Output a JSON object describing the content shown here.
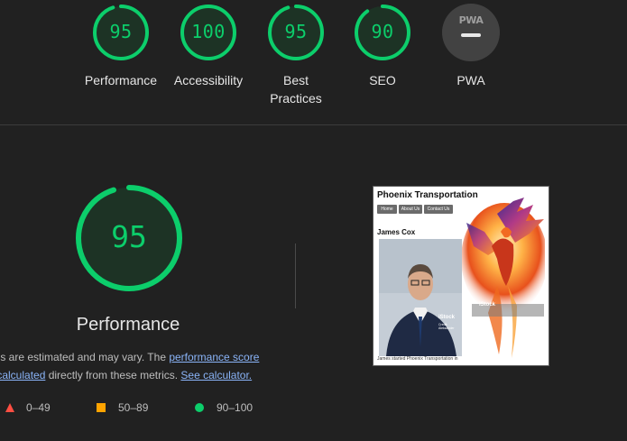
{
  "categories": [
    {
      "id": "performance",
      "score": "95",
      "label": "Performance",
      "value": 95
    },
    {
      "id": "accessibility",
      "score": "100",
      "label": "Accessibility",
      "value": 100
    },
    {
      "id": "best-practices",
      "score": "95",
      "label": "Best Practices",
      "value": 95
    },
    {
      "id": "seo",
      "score": "90",
      "label": "SEO",
      "value": 90
    },
    {
      "id": "pwa",
      "score": "",
      "label": "PWA",
      "badge_text": "PWA"
    }
  ],
  "detail": {
    "score": "95",
    "value": 95,
    "title": "Performance",
    "desc_prefix": "ues are estimated and may vary. The ",
    "desc_link1": "performance score",
    "desc_line2_link": "s calculated",
    "desc_mid": " directly from these metrics. ",
    "desc_link2": "See calculator."
  },
  "legend": [
    {
      "shape": "triangle",
      "range": "0–49",
      "color": "#ff4e42"
    },
    {
      "shape": "square",
      "range": "50–89",
      "color": "#ffa400"
    },
    {
      "shape": "circle",
      "range": "90–100",
      "color": "#0cce6b"
    }
  ],
  "screenshot": {
    "site_title": "Phoenix Transportation",
    "nav": [
      "Home",
      "About Us",
      "Contact Us"
    ],
    "person_name": "James Cox",
    "watermark": "iStock",
    "watermark_sub": "Credit: Aleksander",
    "caption": "James started Phoenix Transportation in"
  },
  "colors": {
    "pass": "#0cce6b",
    "average": "#ffa400",
    "fail": "#ff4e42",
    "background": "#212121",
    "link": "#8ab4f8"
  }
}
